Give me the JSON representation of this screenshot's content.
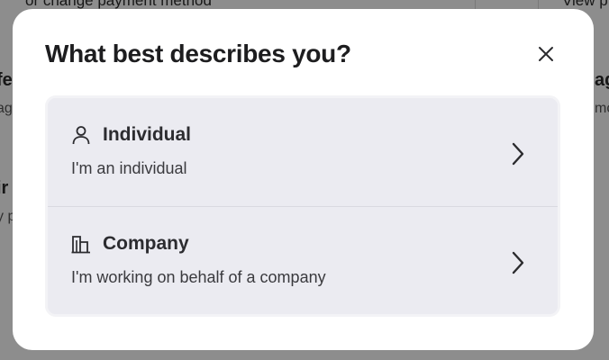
{
  "background": {
    "top_left_text": "or change payment method",
    "top_right_text": "View p",
    "left_heading_1": "fe",
    "left_text_1": "ag",
    "left_heading_2": "ir",
    "left_text_2": "y p",
    "right_heading_1": "ag",
    "right_text_1": "mo"
  },
  "modal": {
    "title": "What best describes you?",
    "close_icon": "close-icon",
    "options": [
      {
        "icon": "person-icon",
        "label": "Individual",
        "description": "I'm an individual",
        "chevron_icon": "chevron-right-icon"
      },
      {
        "icon": "building-icon",
        "label": "Company",
        "description": "I'm working on behalf of a company",
        "chevron_icon": "chevron-right-icon"
      }
    ]
  },
  "colors": {
    "overlay": "#8f8f8f",
    "modal_bg": "#ffffff",
    "option_bg": "#ebebf1",
    "text_primary": "#1d1d1f"
  }
}
